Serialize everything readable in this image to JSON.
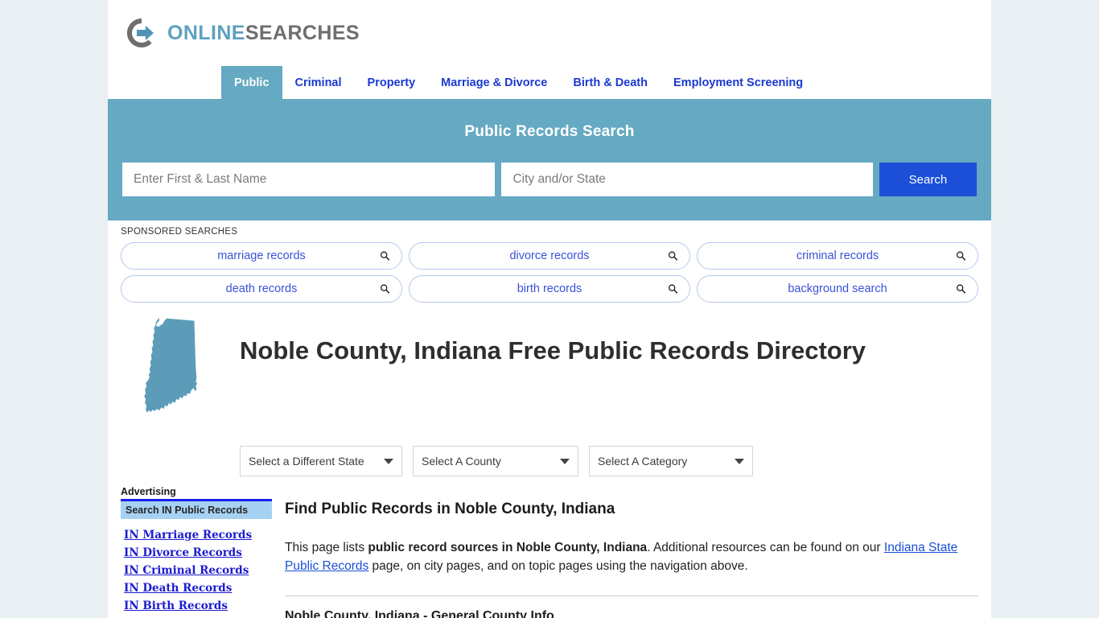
{
  "brand": {
    "logo_icon": "circle-arrow-logo-icon",
    "name_part1": "ONLINE",
    "name_part2": "SEARCHES",
    "color_teal": "#5ea0bf",
    "color_gray": "#6e6e6e"
  },
  "nav": {
    "tabs": [
      {
        "label": "Public",
        "active": true
      },
      {
        "label": "Criminal",
        "active": false
      },
      {
        "label": "Property",
        "active": false
      },
      {
        "label": "Marriage & Divorce",
        "active": false
      },
      {
        "label": "Birth & Death",
        "active": false
      },
      {
        "label": "Employment Screening",
        "active": false
      }
    ],
    "active_bg": "#66a9c2",
    "link_color": "#1a39d1"
  },
  "search_band": {
    "title": "Public Records Search",
    "name_placeholder": "Enter First & Last Name",
    "name_value": "",
    "location_placeholder": "City and/or State",
    "location_value": "",
    "button_label": "Search",
    "band_color": "#66a9c2",
    "button_color": "#1b4fd8"
  },
  "sponsored": {
    "label": "SPONSORED SEARCHES",
    "rows": [
      [
        {
          "label": "marriage records",
          "icon": "search-icon"
        },
        {
          "label": "divorce records",
          "icon": "search-icon"
        },
        {
          "label": "criminal records",
          "icon": "search-icon"
        }
      ],
      [
        {
          "label": "death records",
          "icon": "search-icon"
        },
        {
          "label": "birth records",
          "icon": "search-icon"
        },
        {
          "label": "background search",
          "icon": "search-icon"
        }
      ]
    ]
  },
  "page": {
    "state_map_icon": "indiana-state-map-icon",
    "state_map_color": "#5c9cb8",
    "title": "Noble County, Indiana Free Public Records Directory"
  },
  "filters": [
    {
      "label": "Select a Different State",
      "name": "state-select"
    },
    {
      "label": "Select A County",
      "name": "county-select"
    },
    {
      "label": "Select A Category",
      "name": "category-select"
    }
  ],
  "sidebar": {
    "advertising_label": "Advertising",
    "section_header": "Search IN Public Records",
    "links": [
      "IN Marriage Records",
      "IN Divorce Records",
      "IN Criminal Records",
      "IN Death Records",
      "IN Birth Records"
    ]
  },
  "content": {
    "heading": "Find Public Records in Noble County, Indiana",
    "paragraph": {
      "part1": "This page lists ",
      "bold1": "public record sources in Noble County, Indiana",
      "part2": ". Additional resources can be found on our ",
      "link1": "Indiana State Public Records",
      "part3": " page, on city pages, and on topic pages using the navigation above."
    },
    "section_heading": "Noble County, Indiana - General County Info"
  }
}
